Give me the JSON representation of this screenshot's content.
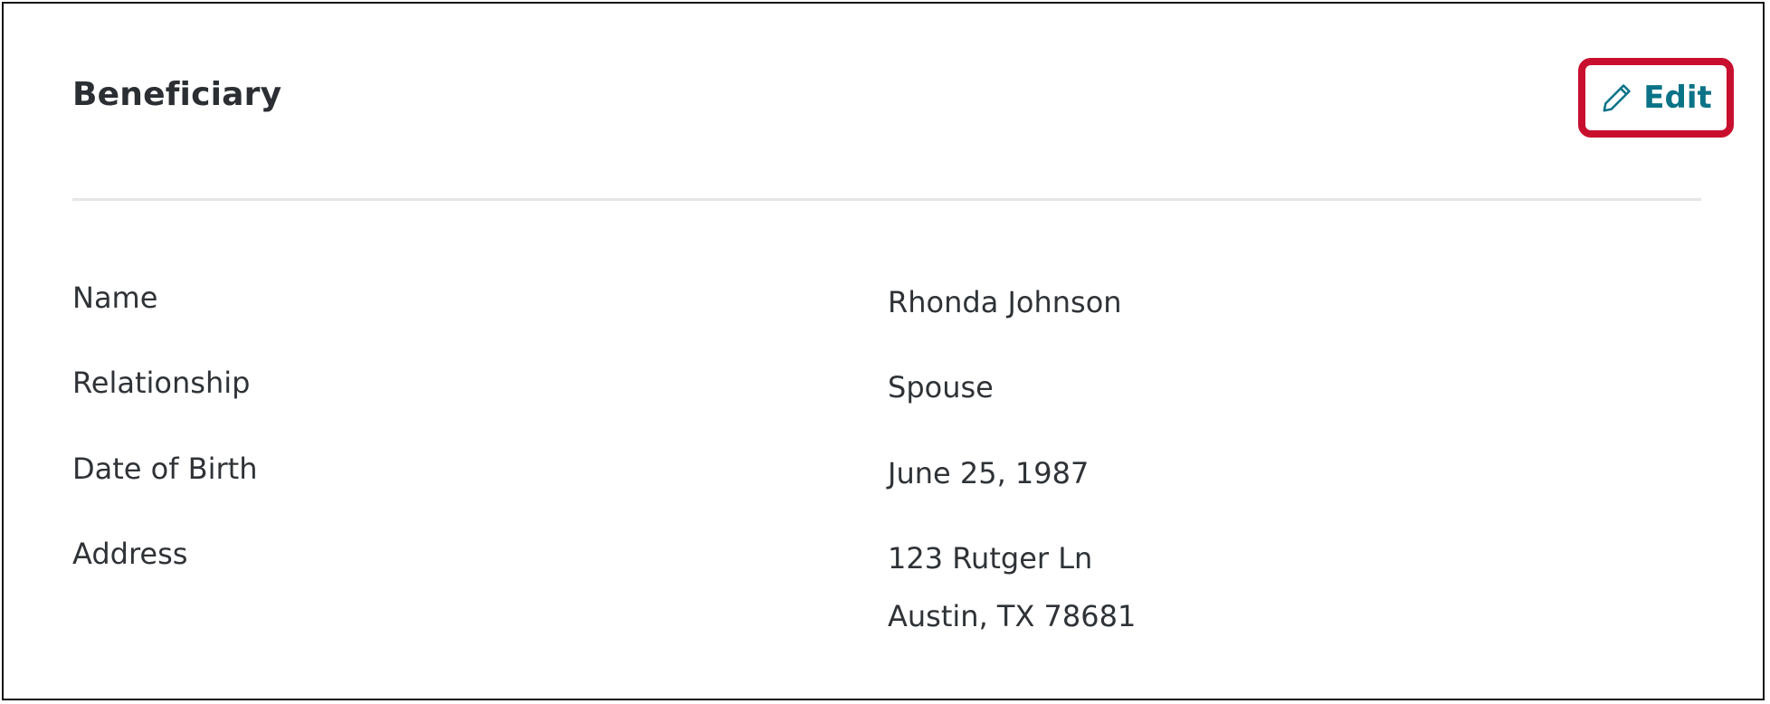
{
  "card": {
    "title": "Beneficiary",
    "edit_label": "Edit",
    "highlight_color": "#c8102e",
    "accent_color": "#0a7387",
    "edit_icon": "pencil-icon"
  },
  "fields": [
    {
      "label": "Name",
      "value": "Rhonda Johnson"
    },
    {
      "label": "Relationship",
      "value": "Spouse"
    },
    {
      "label": "Date of Birth",
      "value": "June 25, 1987"
    },
    {
      "label": "Address",
      "value_line1": "123 Rutger Ln",
      "value_line2": "Austin, TX 78681"
    }
  ]
}
